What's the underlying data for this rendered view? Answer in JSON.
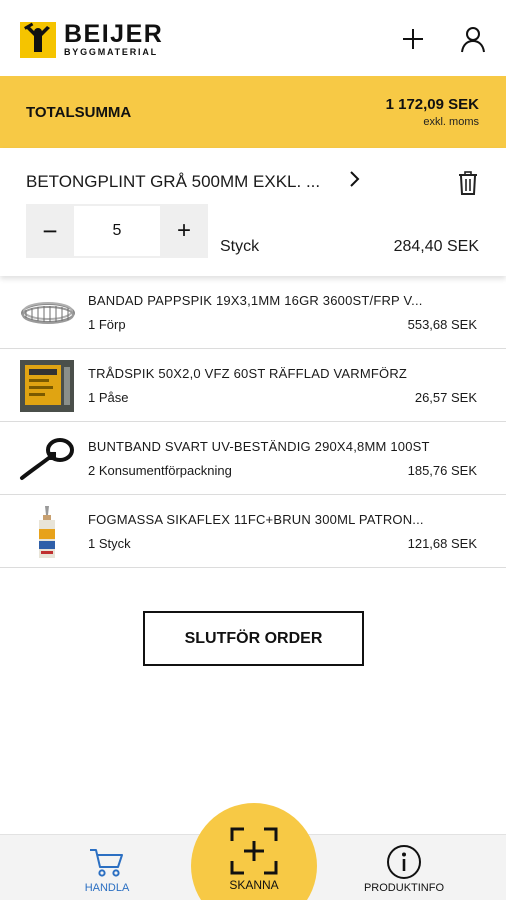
{
  "brand": {
    "name": "BEIJER",
    "sub": "BYGGMATERIAL",
    "color": "#f5c400"
  },
  "header": {
    "add_icon": "plus-icon",
    "user_icon": "user-icon"
  },
  "total": {
    "label": "TOTALSUMMA",
    "amount": "1 172,09 SEK",
    "note": "exkl. moms",
    "color": "#f7c945"
  },
  "expanded_item": {
    "title": "BETONGPLINT GRÅ 500MM EXKL. ...",
    "quantity": "5",
    "minus": "−",
    "plus": "+",
    "unit": "Styck",
    "price": "284,40 SEK"
  },
  "items": [
    {
      "name": "BANDAD PAPPSPIK 19X3,1MM 16GR 3600ST/FRP V...",
      "qty": "1 Förp",
      "price": "553,68 SEK",
      "icon": "coil-nails-image"
    },
    {
      "name": "TRÅDSPIK 50X2,0 VFZ 60ST RÄFFLAD VARMFÖRZ",
      "qty": "1 Påse",
      "price": "26,57 SEK",
      "icon": "nail-package-image"
    },
    {
      "name": "BUNTBAND SVART UV-BESTÄNDIG 290X4,8MM 100ST",
      "qty": "2 Konsumentförpackning",
      "price": "185,76 SEK",
      "icon": "cable-tie-image"
    },
    {
      "name": "FOGMASSA SIKAFLEX 11FC+BRUN 300ML PATRON...",
      "qty": "1 Styck",
      "price": "121,68 SEK",
      "icon": "sealant-tube-image"
    }
  ],
  "checkout": {
    "label": "SLUTFÖR ORDER"
  },
  "nav": {
    "handla": "HANDLA",
    "skanna": "SKANNA",
    "produktinfo": "PRODUKTINFO",
    "active_color": "#2b6fc2"
  }
}
